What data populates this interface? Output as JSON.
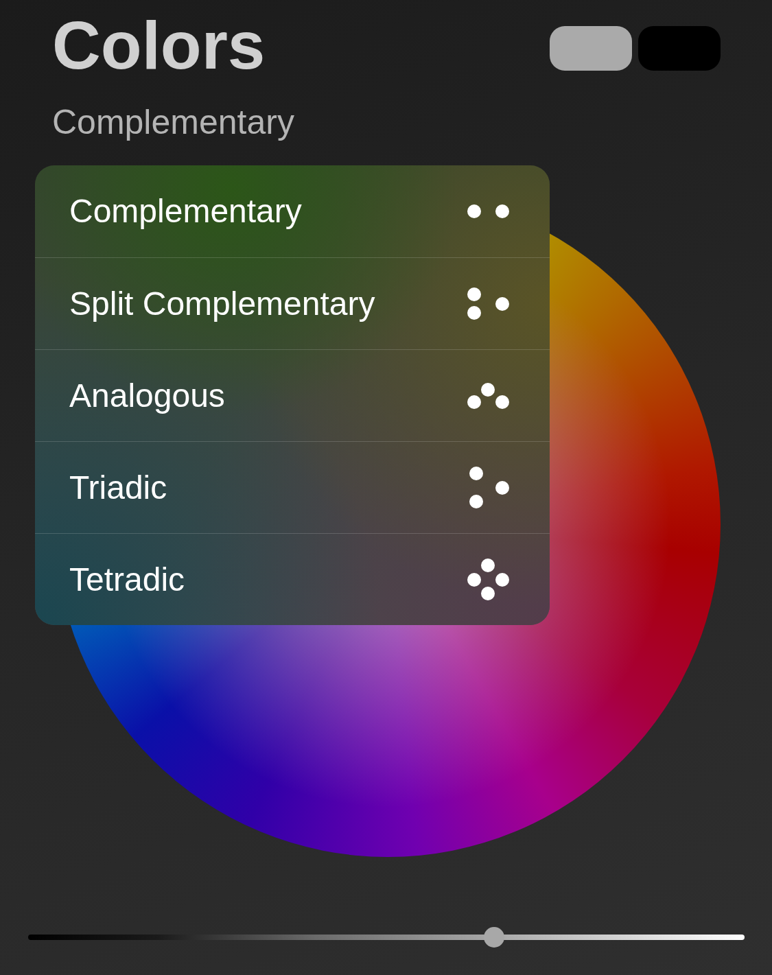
{
  "title": "Colors",
  "swatches": [
    {
      "color": "#aaaaaa"
    },
    {
      "color": "#000000"
    }
  ],
  "harmony": "Complementary",
  "menu": {
    "items": [
      {
        "label": "Complementary",
        "kind": "complementary"
      },
      {
        "label": "Split Complementary",
        "kind": "split"
      },
      {
        "label": "Analogous",
        "kind": "analogous"
      },
      {
        "label": "Triadic",
        "kind": "triadic"
      },
      {
        "label": "Tetradic",
        "kind": "tetradic"
      }
    ]
  },
  "slider": {
    "level": 0.65
  }
}
